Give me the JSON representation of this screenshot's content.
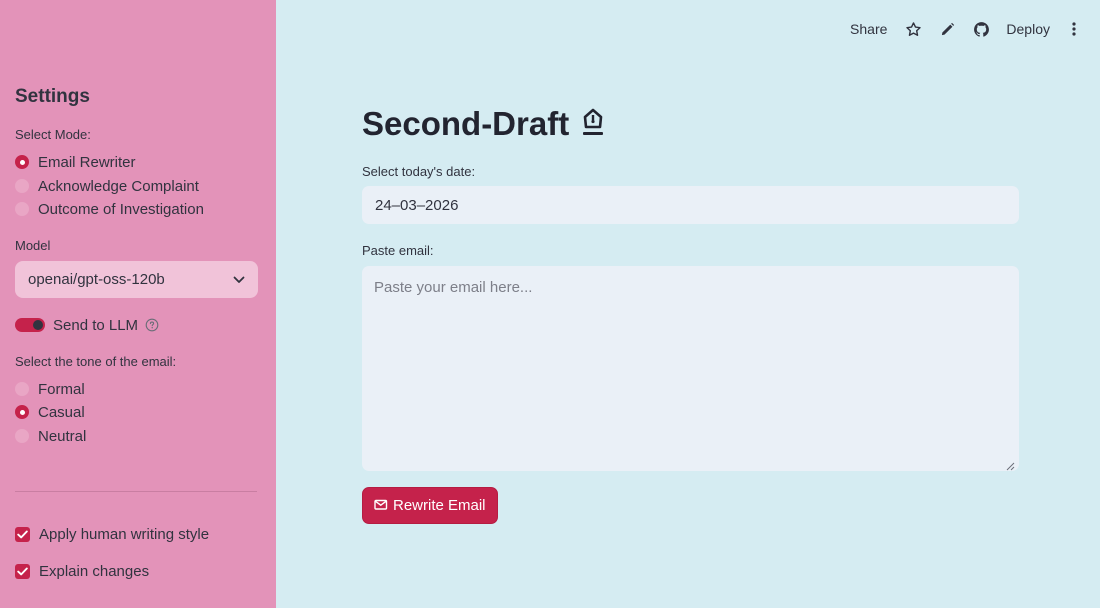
{
  "toolbar": {
    "share_label": "Share",
    "deploy_label": "Deploy"
  },
  "sidebar": {
    "title": "Settings",
    "mode": {
      "label": "Select Mode:",
      "options": [
        "Email Rewriter",
        "Acknowledge Complaint",
        "Outcome of Investigation"
      ],
      "selected": "Email Rewriter"
    },
    "model": {
      "label": "Model",
      "value": "openai/gpt-oss-120b"
    },
    "send_to_llm": {
      "label": "Send to LLM",
      "enabled": true
    },
    "tone": {
      "label": "Select the tone of the email:",
      "options": [
        "Formal",
        "Casual",
        "Neutral"
      ],
      "selected": "Casual"
    },
    "checkboxes": [
      {
        "label": "Apply human writing style",
        "checked": true
      },
      {
        "label": "Explain changes",
        "checked": true
      }
    ]
  },
  "main": {
    "title": "Second-Draft",
    "date": {
      "label": "Select today's date:",
      "value": "24–03–2026"
    },
    "email": {
      "label": "Paste email:",
      "placeholder": "Paste your email here..."
    },
    "rewrite_button_label": "Rewrite Email"
  },
  "colors": {
    "sidebar_bg": "#e393b9",
    "main_bg": "#d5ecf2",
    "accent": "#c5224b"
  }
}
